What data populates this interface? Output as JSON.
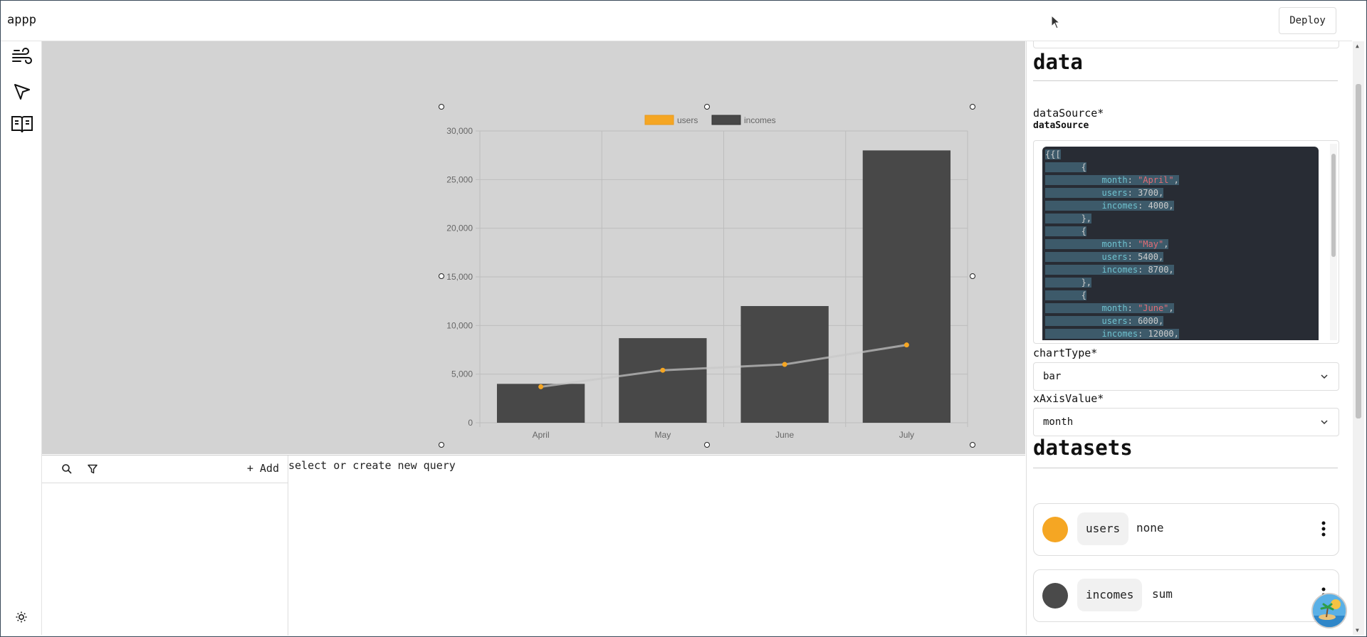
{
  "app": {
    "title": "appp",
    "deploy_label": "Deploy"
  },
  "rail": {
    "items": [
      {
        "icon": "wind-icon"
      },
      {
        "icon": "cursor-arrow-icon"
      },
      {
        "icon": "book-open-icon"
      }
    ],
    "theme_icon": "sun-icon"
  },
  "chart_data": {
    "type": "bar",
    "categories": [
      "April",
      "May",
      "June",
      "July"
    ],
    "series": [
      {
        "name": "users",
        "chart": "line",
        "values": [
          3700,
          5400,
          6000,
          8000
        ],
        "color": "#f5a623"
      },
      {
        "name": "incomes",
        "chart": "bar",
        "values": [
          4000,
          8700,
          12000,
          28000
        ],
        "color": "#484848"
      }
    ],
    "ylim": [
      0,
      30000
    ],
    "yticks": [
      0,
      5000,
      10000,
      15000,
      20000,
      25000,
      30000
    ],
    "ytick_labels": [
      "0",
      "5,000",
      "10,000",
      "15,000",
      "20,000",
      "25,000",
      "30,000"
    ],
    "grid": true,
    "legend": "top-center"
  },
  "query": {
    "add_label": "+ Add",
    "empty_message": "select or create new query"
  },
  "inspector": {
    "data_heading": "data",
    "data_source_label": "dataSource*",
    "data_source_sub": "dataSource",
    "code": {
      "open": "{{[",
      "brace_open": "{",
      "brace_close": "},",
      "key_month": "month",
      "key_users": "users",
      "key_incomes": "incomes",
      "rows": [
        {
          "month": "\"April\"",
          "users": "3700",
          "incomes": "4000"
        },
        {
          "month": "\"May\"",
          "users": "5400",
          "incomes": "8700"
        },
        {
          "month": "\"June\"",
          "users": "6000",
          "incomes": "12000"
        }
      ]
    },
    "chart_type_label": "chartType*",
    "chart_type_value": "bar",
    "x_axis_label": "xAxisValue*",
    "x_axis_value": "month",
    "datasets_heading": "datasets",
    "datasets": [
      {
        "name": "users",
        "aggregation": "none",
        "color": "#f5a623"
      },
      {
        "name": "incomes",
        "aggregation": "sum",
        "color": "#4a4a4a"
      }
    ]
  }
}
